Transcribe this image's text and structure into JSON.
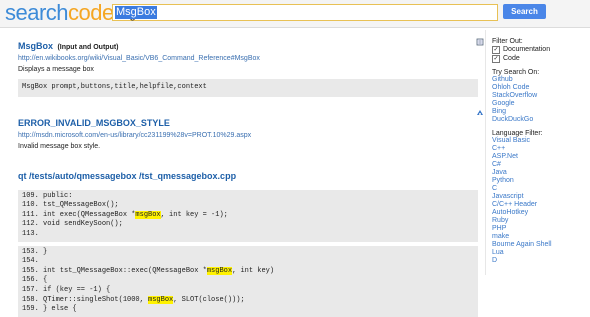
{
  "header": {
    "logo_part1": "search",
    "logo_part2": "code",
    "search_value": "MsgBox",
    "search_button": "Search"
  },
  "results": [
    {
      "title": "MsgBox",
      "subtitle": "(Input and Output)",
      "url": "http://en.wikibooks.org/wiki/Visual_Basic/VB6_Command_Reference#MsgBox",
      "description": "Displays a message box",
      "code": "MsgBox prompt,buttons,title,helpfile,context",
      "icon": "book-icon"
    },
    {
      "title": "ERROR_INVALID_MSGBOX_STYLE",
      "url": "http://msdn.microsoft.com/en-us/library/cc231199%28v=PROT.10%29.aspx",
      "description": "Invalid message box style.",
      "icon": "msdn-icon"
    },
    {
      "title": "qt /tests/auto/qmessagebox /tst_qmessagebox.cpp",
      "block1": [
        {
          "pre": "109. public:",
          "hl": "",
          "post": ""
        },
        {
          "pre": "110. tst_QMessageBox();",
          "hl": "",
          "post": ""
        },
        {
          "pre": "111. int exec(QMessageBox *",
          "hl": "msgBox",
          "post": ", int key = -1);"
        },
        {
          "pre": "112. void sendKeySoon();",
          "hl": "",
          "post": ""
        },
        {
          "pre": "113.",
          "hl": "",
          "post": ""
        }
      ],
      "block2": [
        {
          "pre": "153. }",
          "hl": "",
          "post": ""
        },
        {
          "pre": "154.",
          "hl": "",
          "post": ""
        },
        {
          "pre": "155. int tst_QMessageBox::exec(QMessageBox *",
          "hl": "msgBox",
          "post": ", int key)"
        },
        {
          "pre": "156. {",
          "hl": "",
          "post": ""
        },
        {
          "pre": "157. if (key == -1) {",
          "hl": "",
          "post": ""
        },
        {
          "pre": "158. QTimer::singleShot(1000, ",
          "hl": "msgBox",
          "post": ", SLOT(close()));"
        },
        {
          "pre": "159. } else {",
          "hl": "",
          "post": ""
        }
      ]
    }
  ],
  "sidebar": {
    "filter_heading": "Filter Out:",
    "filters": [
      {
        "label": "Documentation",
        "checked": "✓"
      },
      {
        "label": "Code",
        "checked": "✓"
      }
    ],
    "try_heading": "Try Search On:",
    "try_links": [
      "Github",
      "Ohloh Code",
      "StackOverflow",
      "Google",
      "Bing",
      "DuckDuckGo"
    ],
    "language_heading": "Language Filter:",
    "languages": [
      "Visual Basic",
      "C++",
      "ASP.Net",
      "C#",
      "Java",
      "Python",
      "C",
      "Javascript",
      "C/C++ Header",
      "AutoHotkey",
      "Ruby",
      "PHP",
      "make",
      "Bourne Again Shell",
      "Lua",
      "D"
    ]
  },
  "colors": {
    "accent": "#4a86e8",
    "link": "#1d5fa8",
    "highlight": "#fff200",
    "logo_blue": "#3d8bd8",
    "logo_orange": "#f5a623"
  }
}
